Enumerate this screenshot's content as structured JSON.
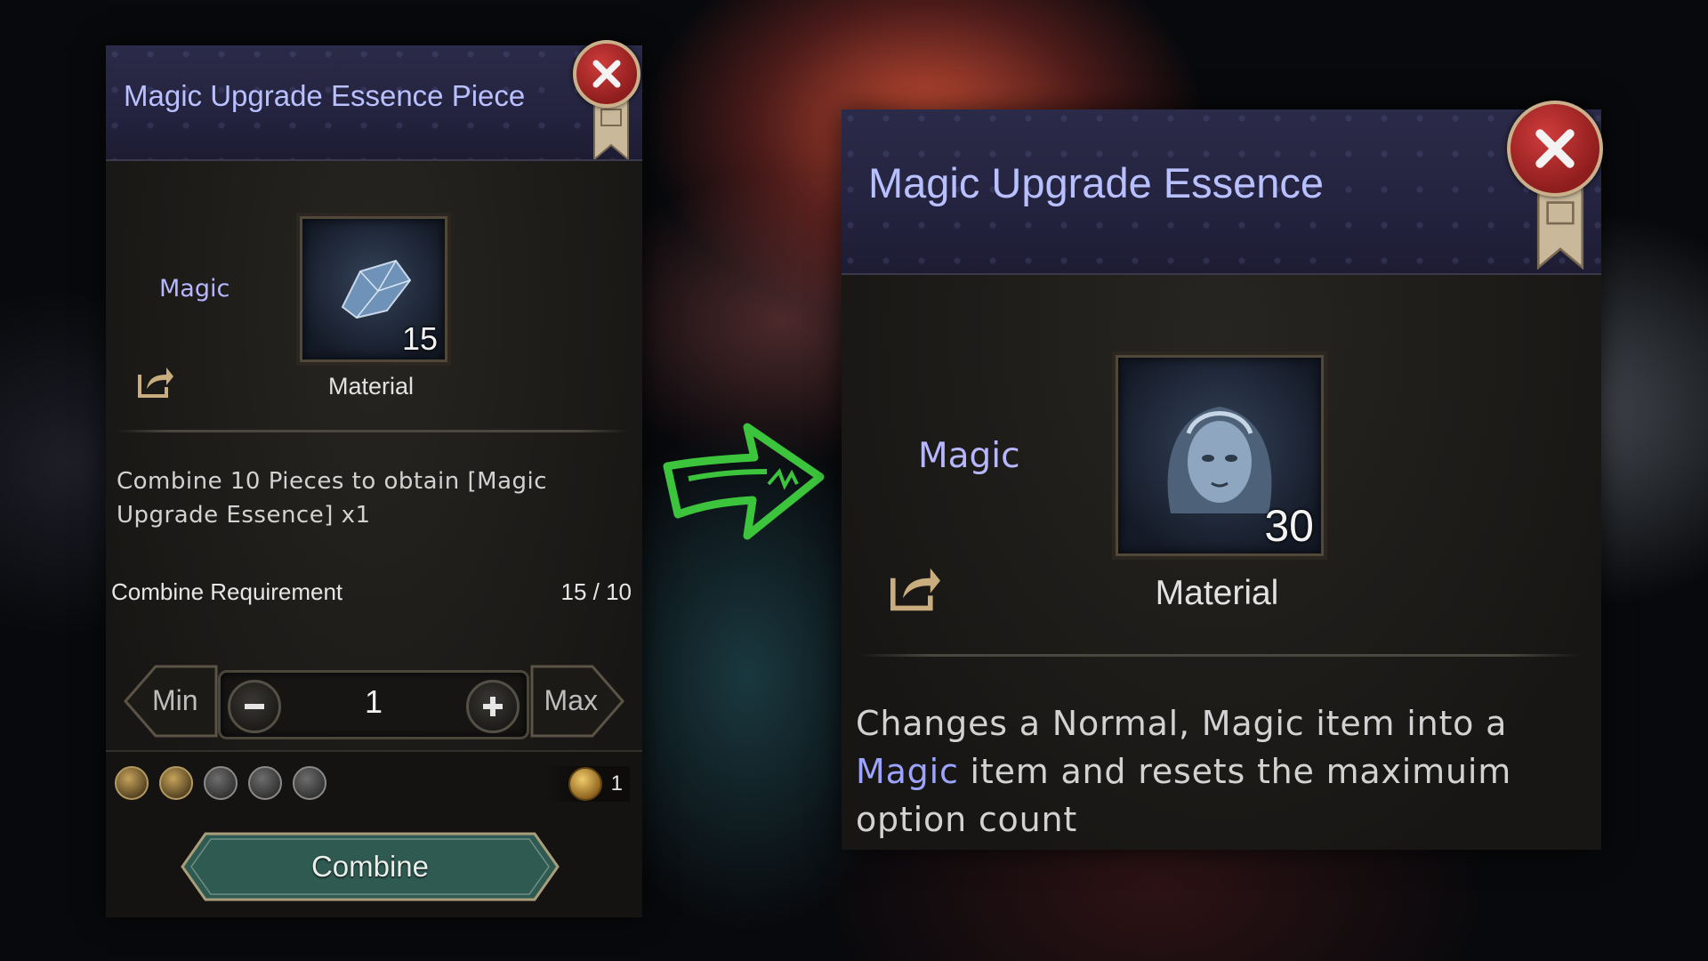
{
  "left_panel": {
    "title": "Magic Upgrade Essence Piece",
    "rarity": "Magic",
    "item_count": "15",
    "item_type": "Material",
    "description": "Combine 10 Pieces to obtain [Magic Upgrade Essence] x1",
    "requirement_label": "Combine Requirement",
    "requirement_value": "15 / 10",
    "min_label": "Min",
    "max_label": "Max",
    "quantity": "1",
    "cost_value": "1",
    "combine_label": "Combine"
  },
  "right_panel": {
    "title": "Magic Upgrade Essence",
    "rarity": "Magic",
    "item_count": "30",
    "item_type": "Material",
    "description_parts": {
      "before": "Changes a Normal, Magic item into a ",
      "highlight": "Magic",
      "after": " item and resets the maximuim option count"
    }
  },
  "colors": {
    "title": "#b9c0ff",
    "rarity_magic": "#b7b7ff",
    "highlight": "#9da4ff",
    "arrow_green": "#3cc43c",
    "close_red": "#b52a2a"
  },
  "icons": [
    "close-icon",
    "ribbon-icon",
    "share-icon",
    "minus-icon",
    "plus-icon",
    "bag-icon",
    "chest-icon",
    "blade-icon",
    "crossed-tools-icon",
    "feather-icon",
    "coin-icon",
    "green-arrow-icon"
  ]
}
